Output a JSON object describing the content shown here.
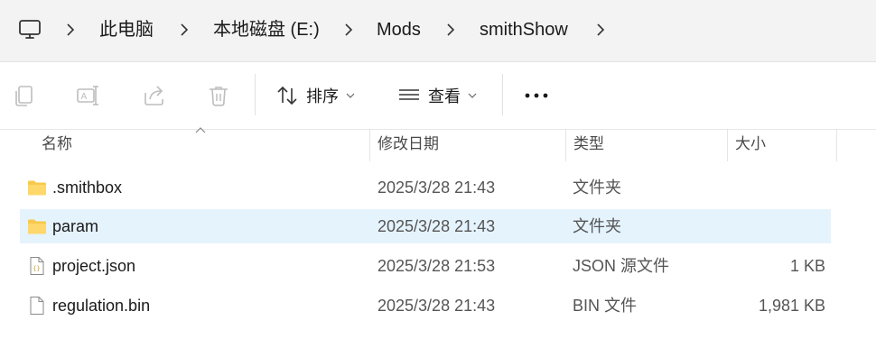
{
  "breadcrumb": {
    "items": [
      "此电脑",
      "本地磁盘 (E:)",
      "Mods",
      "smithShow"
    ]
  },
  "toolbar": {
    "sort_label": "排序",
    "view_label": "查看",
    "more_label": "•••"
  },
  "columns": {
    "name": "名称",
    "date": "修改日期",
    "type": "类型",
    "size": "大小"
  },
  "files": [
    {
      "name": ".smithbox",
      "date": "2025/3/28 21:43",
      "type": "文件夹",
      "size": "",
      "icon": "folder-icon"
    },
    {
      "name": "param",
      "date": "2025/3/28 21:43",
      "type": "文件夹",
      "size": "",
      "icon": "folder-icon",
      "selected": true
    },
    {
      "name": "project.json",
      "date": "2025/3/28 21:53",
      "type": "JSON 源文件",
      "size": "1 KB",
      "icon": "json-file-icon"
    },
    {
      "name": "regulation.bin",
      "date": "2025/3/28 21:43",
      "type": "BIN 文件",
      "size": "1,981 KB",
      "icon": "file-icon"
    }
  ],
  "colors": {
    "selection": "#e5f3fd",
    "folder": "#f8c94a",
    "addressbar_bg": "#f3f3f3"
  }
}
